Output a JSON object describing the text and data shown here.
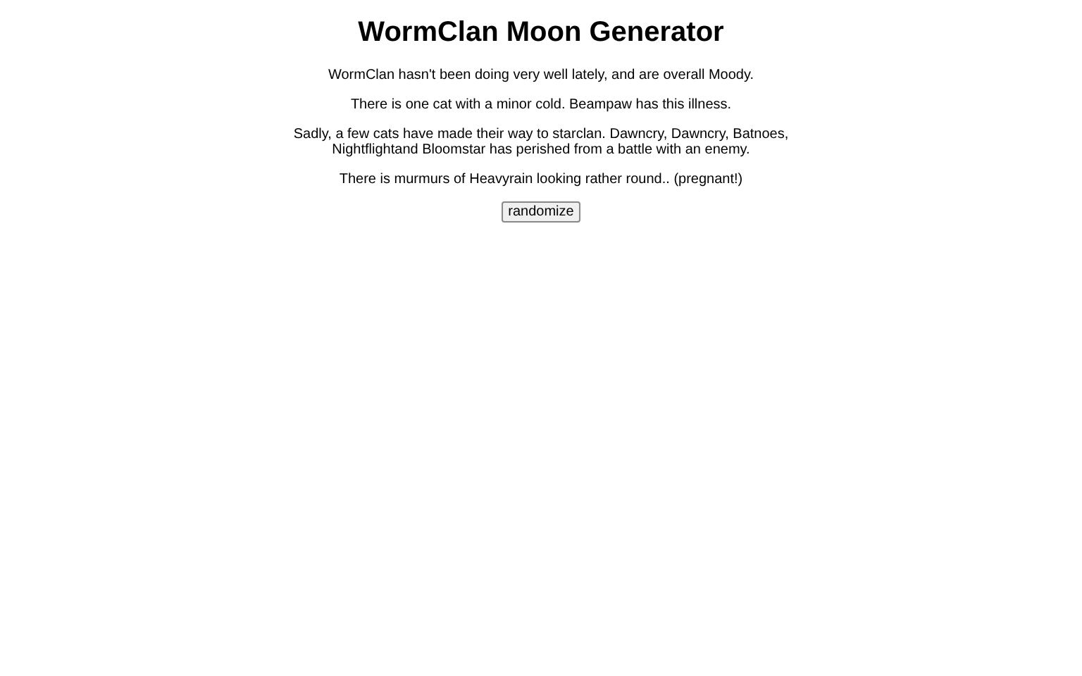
{
  "title": "WormClan Moon Generator",
  "paragraphs": [
    "WormClan hasn't been doing very well lately, and are overall Moody.",
    "There is one cat with a minor cold. Beampaw has this illness.",
    "Sadly, a few cats have made their way to starclan. Dawncry, Dawncry, Batnoes, Nightflightand Bloomstar has perished from a battle with an enemy.",
    "There is murmurs of Heavyrain looking rather round.. (pregnant!)"
  ],
  "button": "randomize"
}
